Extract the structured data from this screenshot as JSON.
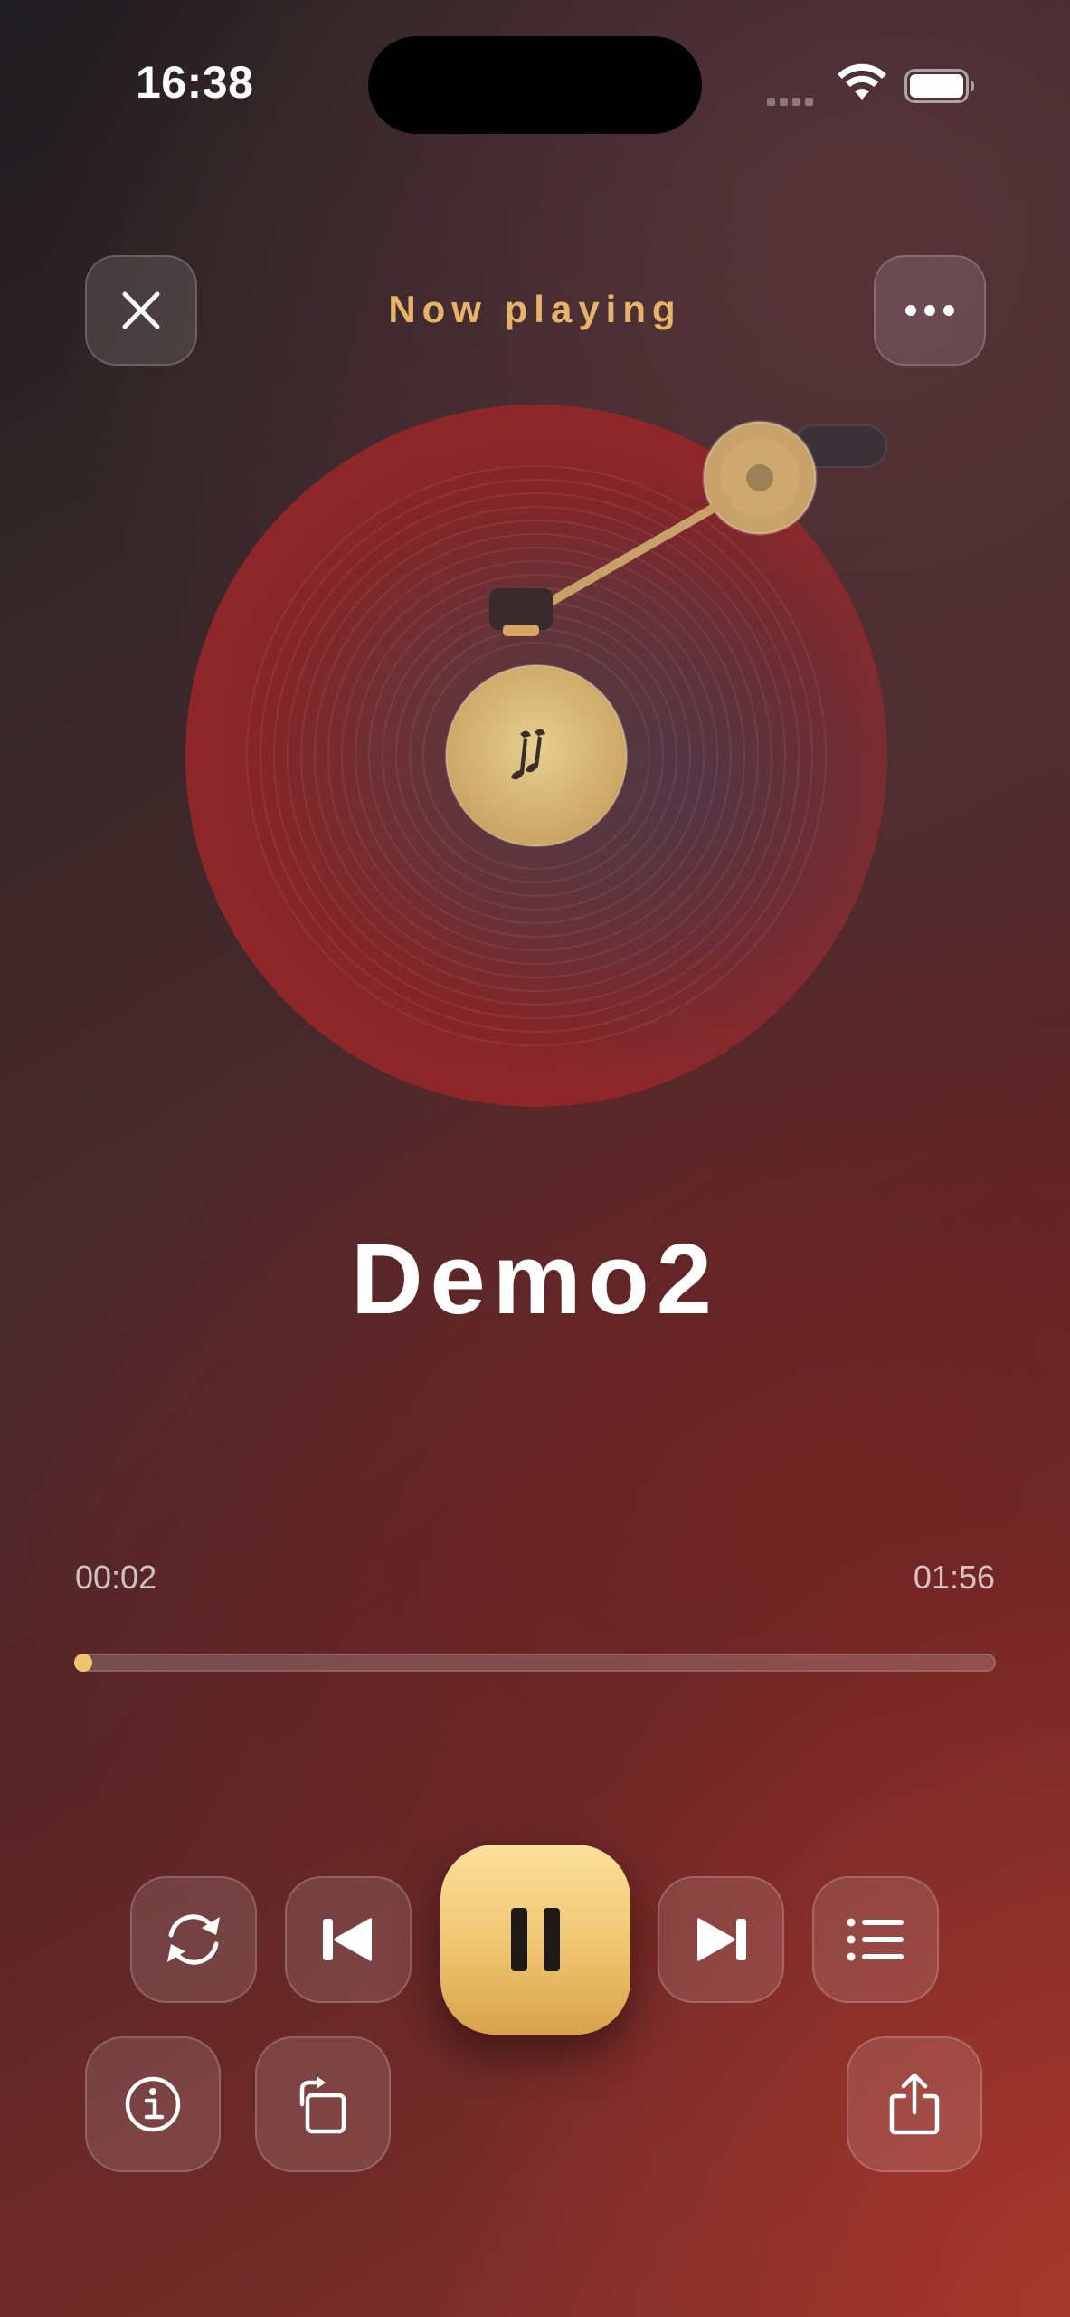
{
  "status_bar": {
    "time": "16:38"
  },
  "header": {
    "title": "Now playing"
  },
  "track": {
    "title": "Demo2",
    "elapsed": "00:02",
    "total": "01:56",
    "progress": 0.017
  },
  "icons": {
    "close": "close-icon",
    "more": "more-icon",
    "repeat": "repeat-icon",
    "previous": "previous-icon",
    "pause": "pause-icon",
    "next": "next-icon",
    "playlist": "list-icon",
    "info": "info-icon",
    "rotate": "rotate-icon",
    "share": "share-icon",
    "music_note": "music-note-icon"
  },
  "colors": {
    "accent": "#f0c46f",
    "title_accent": "#e7b36a",
    "record": "#8d2426"
  }
}
